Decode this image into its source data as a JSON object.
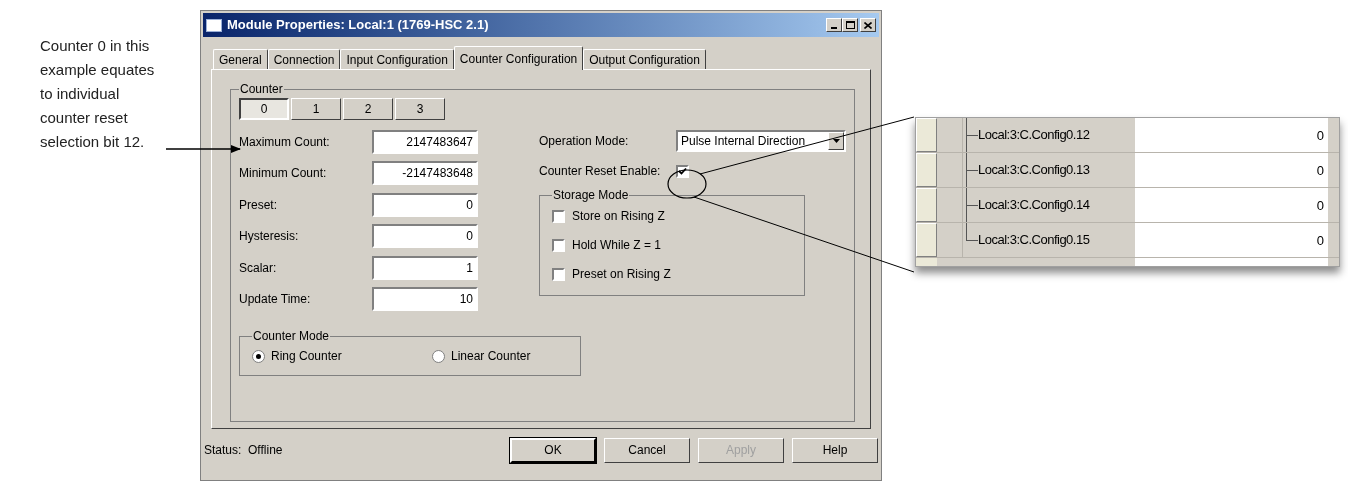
{
  "caption": "Counter 0 in this example equates to individual counter reset selection bit 12.",
  "window": {
    "title": "Module Properties: Local:1 (1769-HSC 2.1)"
  },
  "tabs": [
    {
      "label": "General",
      "selected": false
    },
    {
      "label": "Connection",
      "selected": false
    },
    {
      "label": "Input Configuration",
      "selected": false
    },
    {
      "label": "Counter Configuration",
      "selected": true
    },
    {
      "label": "Output Configuration",
      "selected": false
    }
  ],
  "counter_group": {
    "label": "Counter",
    "buttons": [
      {
        "label": "0",
        "selected": true
      },
      {
        "label": "1",
        "selected": false
      },
      {
        "label": "2",
        "selected": false
      },
      {
        "label": "3",
        "selected": false
      }
    ]
  },
  "field_groups": [
    [
      {
        "label": "Maximum Count:",
        "value": "2147483647"
      },
      {
        "label": "Minimum Count:",
        "value": "-2147483648"
      }
    ],
    [
      {
        "label": "Preset:",
        "value": "0"
      },
      {
        "label": "Hysteresis:",
        "value": "0"
      }
    ],
    [
      {
        "label": "Scalar:",
        "value": "1"
      },
      {
        "label": "Update Time:",
        "value": "10"
      }
    ]
  ],
  "operation_mode": {
    "label": "Operation Mode:",
    "value": "Pulse Internal Direction"
  },
  "counter_reset_enable": {
    "label": "Counter Reset Enable:",
    "checked": true
  },
  "storage_mode": {
    "label": "Storage Mode",
    "options": [
      {
        "label": "Store on Rising Z",
        "checked": false
      },
      {
        "label": "Hold While Z = 1",
        "checked": false
      },
      {
        "label": "Preset on Rising Z",
        "checked": false
      }
    ]
  },
  "counter_mode": {
    "label": "Counter Mode",
    "options": [
      {
        "label": "Ring Counter",
        "selected": true
      },
      {
        "label": "Linear Counter",
        "selected": false
      }
    ]
  },
  "status_bar": {
    "label": "Status:",
    "value": "Offline"
  },
  "buttons": [
    {
      "label": "OK",
      "disabled": false,
      "default": true
    },
    {
      "label": "Cancel",
      "disabled": false,
      "default": false
    },
    {
      "label": "Apply",
      "disabled": true,
      "default": false
    },
    {
      "label": "Help",
      "disabled": false,
      "default": false
    }
  ],
  "tag_table": {
    "rows": [
      {
        "name": "Local:3:C.Config0.12",
        "value": "0"
      },
      {
        "name": "Local:3:C.Config0.13",
        "value": "0"
      },
      {
        "name": "Local:3:C.Config0.14",
        "value": "0"
      },
      {
        "name": "Local:3:C.Config0.15",
        "value": "0"
      }
    ]
  }
}
